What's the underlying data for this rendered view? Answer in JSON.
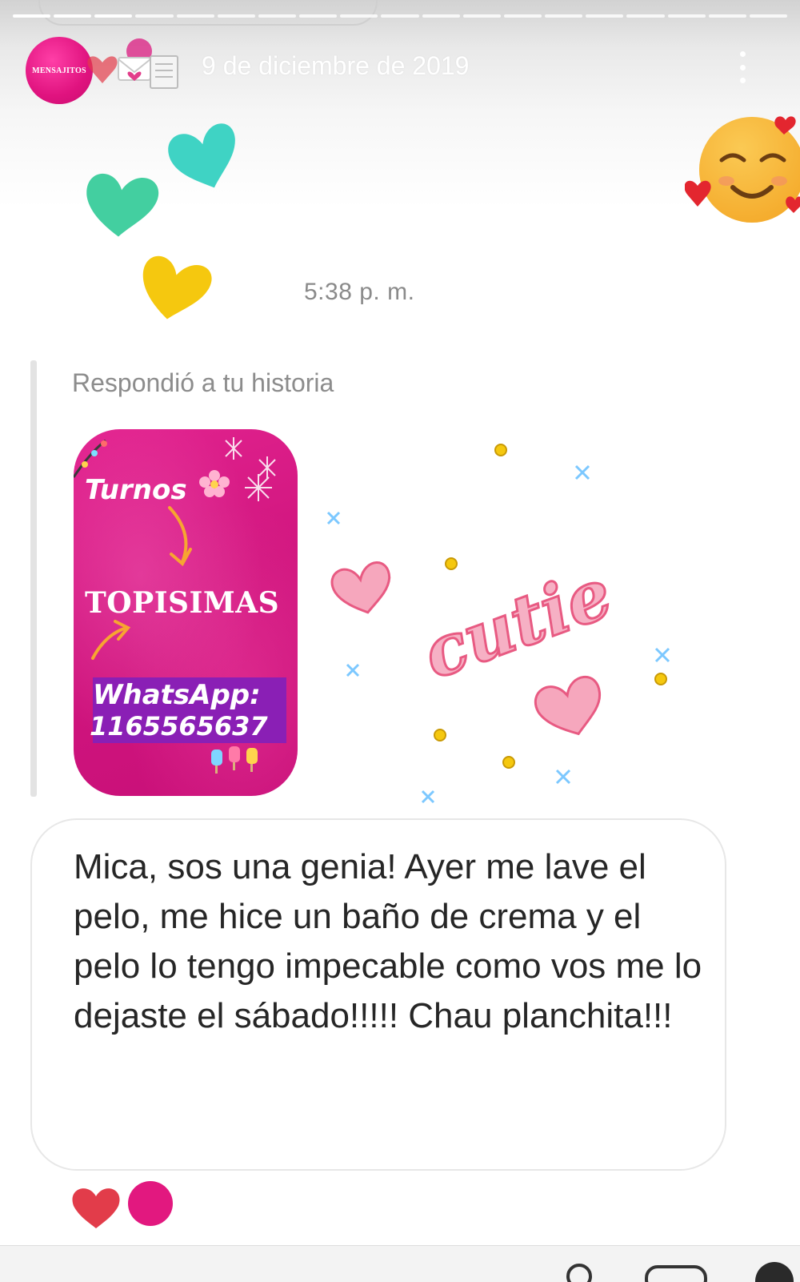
{
  "header": {
    "avatar_label": "MENSAJITOS",
    "date": "9 de diciembre de 2019",
    "more_icon": "more-vertical-icon"
  },
  "thread": {
    "time": "5:38 p. m.",
    "reply_context": "Respondió a tu historia",
    "story": {
      "turnos": "Turnos",
      "brand": "TOPISIMAS",
      "whatsapp_label": "WhatsApp:",
      "whatsapp_number": "1165565637"
    },
    "sticker_text": "cutie",
    "message": "Mica, sos una genia! Ayer me lave el pelo, me hice un baño de crema y el pelo lo tengo impecable como vos me lo dejaste el sábado!!!!! Chau planchita!!!"
  },
  "colors": {
    "brand_pink": "#e2187f",
    "heart_red": "#e23c4a",
    "teal": "#3fd3c4",
    "mint": "#43cfa0",
    "yellow": "#f5c80f",
    "whatsapp_box": "#8a1fb5",
    "text_gray": "#8a8a8a"
  },
  "icons": [
    "smiling-face-with-hearts-icon",
    "heart-icon",
    "envelope-heart-icon",
    "notepad-icon",
    "flower-icon",
    "snowflake-icon",
    "arrow-icon",
    "popsicle-icon",
    "camera-icon",
    "sticker-icon"
  ]
}
